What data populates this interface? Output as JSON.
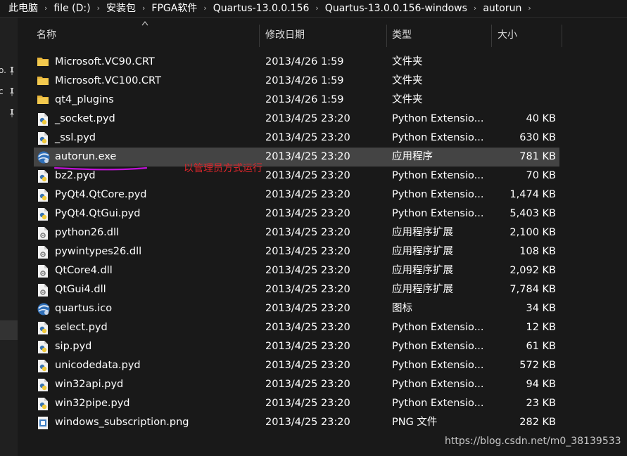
{
  "breadcrumb": {
    "items": [
      "此电脑",
      "file (D:)",
      "安装包",
      "FPGA软件",
      "Quartus-13.0.0.156",
      "Quartus-13.0.0.156-windows",
      "autorun"
    ]
  },
  "navpane": {
    "items": [
      {
        "label": "o.",
        "icon": "pin-icon"
      },
      {
        "label": "c",
        "icon": "pin-icon"
      },
      {
        "label": "",
        "icon": "pin-icon"
      }
    ]
  },
  "columns": {
    "name": "名称",
    "date": "修改日期",
    "type": "类型",
    "size": "大小"
  },
  "files": [
    {
      "name": "Microsoft.VC90.CRT",
      "date": "2013/4/26 1:59",
      "type": "文件夹",
      "size": "",
      "icon": "folder-icon"
    },
    {
      "name": "Microsoft.VC100.CRT",
      "date": "2013/4/26 1:59",
      "type": "文件夹",
      "size": "",
      "icon": "folder-icon"
    },
    {
      "name": "qt4_plugins",
      "date": "2013/4/26 1:59",
      "type": "文件夹",
      "size": "",
      "icon": "folder-icon"
    },
    {
      "name": "_socket.pyd",
      "date": "2013/4/25 23:20",
      "type": "Python Extensio...",
      "size": "40 KB",
      "icon": "python-file-icon"
    },
    {
      "name": "_ssl.pyd",
      "date": "2013/4/25 23:20",
      "type": "Python Extensio...",
      "size": "630 KB",
      "icon": "python-file-icon"
    },
    {
      "name": "autorun.exe",
      "date": "2013/4/25 23:20",
      "type": "应用程序",
      "size": "781 KB",
      "icon": "quartus-exe-icon",
      "selected": true
    },
    {
      "name": "bz2.pyd",
      "date": "2013/4/25 23:20",
      "type": "Python Extensio...",
      "size": "70 KB",
      "icon": "python-file-icon"
    },
    {
      "name": "PyQt4.QtCore.pyd",
      "date": "2013/4/25 23:20",
      "type": "Python Extensio...",
      "size": "1,474 KB",
      "icon": "python-file-icon"
    },
    {
      "name": "PyQt4.QtGui.pyd",
      "date": "2013/4/25 23:20",
      "type": "Python Extensio...",
      "size": "5,403 KB",
      "icon": "python-file-icon"
    },
    {
      "name": "python26.dll",
      "date": "2013/4/25 23:20",
      "type": "应用程序扩展",
      "size": "2,100 KB",
      "icon": "dll-file-icon"
    },
    {
      "name": "pywintypes26.dll",
      "date": "2013/4/25 23:20",
      "type": "应用程序扩展",
      "size": "108 KB",
      "icon": "dll-file-icon"
    },
    {
      "name": "QtCore4.dll",
      "date": "2013/4/25 23:20",
      "type": "应用程序扩展",
      "size": "2,092 KB",
      "icon": "dll-file-icon"
    },
    {
      "name": "QtGui4.dll",
      "date": "2013/4/25 23:20",
      "type": "应用程序扩展",
      "size": "7,784 KB",
      "icon": "dll-file-icon"
    },
    {
      "name": "quartus.ico",
      "date": "2013/4/25 23:20",
      "type": "图标",
      "size": "34 KB",
      "icon": "quartus-ico-icon"
    },
    {
      "name": "select.pyd",
      "date": "2013/4/25 23:20",
      "type": "Python Extensio...",
      "size": "12 KB",
      "icon": "python-file-icon"
    },
    {
      "name": "sip.pyd",
      "date": "2013/4/25 23:20",
      "type": "Python Extensio...",
      "size": "61 KB",
      "icon": "python-file-icon"
    },
    {
      "name": "unicodedata.pyd",
      "date": "2013/4/25 23:20",
      "type": "Python Extensio...",
      "size": "572 KB",
      "icon": "python-file-icon"
    },
    {
      "name": "win32api.pyd",
      "date": "2013/4/25 23:20",
      "type": "Python Extensio...",
      "size": "94 KB",
      "icon": "python-file-icon"
    },
    {
      "name": "win32pipe.pyd",
      "date": "2013/4/25 23:20",
      "type": "Python Extensio...",
      "size": "23 KB",
      "icon": "python-file-icon"
    },
    {
      "name": "windows_subscription.png",
      "date": "2013/4/25 23:20",
      "type": "PNG 文件",
      "size": "282 KB",
      "icon": "png-file-icon"
    }
  ],
  "annotation": {
    "text": "以管理员方式运行",
    "color": "#e0262b",
    "underline_color": "#c011d8"
  },
  "watermark": "https://blog.csdn.net/m0_38139533",
  "colors": {
    "background": "#191919",
    "selected_row": "#444444",
    "folder": "#e8b53a"
  }
}
